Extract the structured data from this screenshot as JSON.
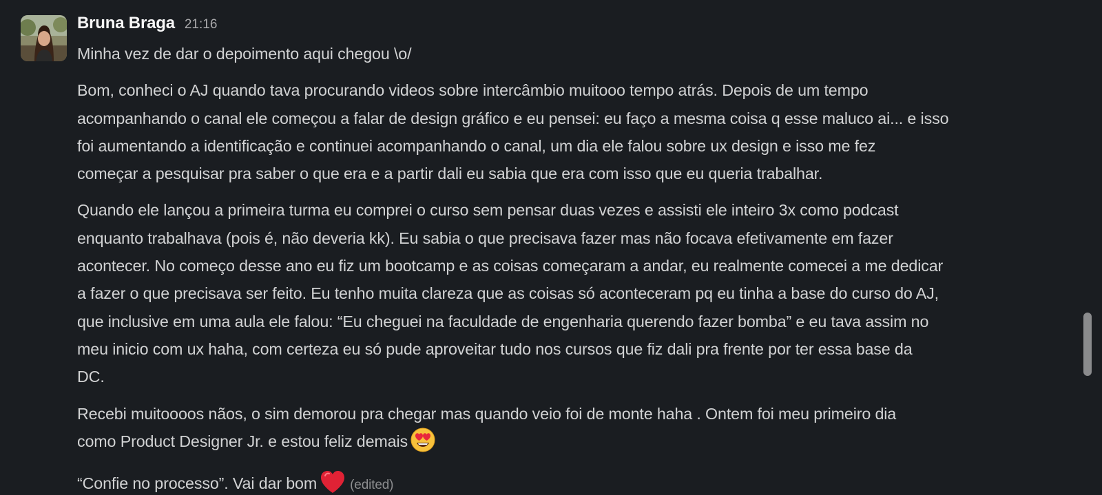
{
  "message": {
    "author": "Bruna Braga",
    "time": "21:16",
    "intro": "Minha vez de dar o depoimento aqui chegou \\o/",
    "p1": [
      "Bom, conheci o AJ quando tava procurando videos sobre intercâmbio muitooo tempo atrás. Depois de um tempo",
      "acompanhando o canal ele começou a falar de design gráfico e eu pensei: eu faço a mesma coisa q esse maluco ai... e isso",
      "foi aumentando a identificação e continuei acompanhando o canal, um dia ele falou sobre ux design e isso me fez",
      "começar a pesquisar pra saber o que era e a partir dali eu sabia que era com isso que eu queria trabalhar."
    ],
    "p2": [
      "Quando ele lançou a primeira turma eu comprei o curso sem pensar duas vezes e assisti ele inteiro 3x como podcast",
      "enquanto trabalhava (pois é, não deveria kk). Eu sabia o que precisava fazer mas não focava efetivamente em fazer",
      "acontecer. No começo desse ano eu fiz um bootcamp e as coisas começaram a andar, eu realmente comecei a me dedicar",
      "a fazer o que precisava ser feito. Eu tenho muita clareza que as coisas só aconteceram pq eu tinha a base do curso do AJ,",
      "que inclusive em uma aula ele falou: “Eu cheguei na faculdade de engenharia querendo fazer bomba” e eu tava assim no",
      "meu inicio com ux haha, com certeza eu só pude aproveitar tudo nos cursos que fiz dali pra frente por ter essa base da",
      "DC."
    ],
    "p3": [
      "Recebi muitoooos nãos, o sim demorou pra chegar mas quando veio foi de monte haha . Ontem foi meu primeiro dia",
      "como Product Designer Jr. e estou feliz demais"
    ],
    "p4": "“Confie no processo”. Vai dar bom",
    "edited": "(edited)",
    "emoji_1": "heart-eyes-emoji",
    "emoji_2": "red-heart-emoji"
  },
  "colors": {
    "background": "#1a1d21",
    "text": "#d1d2d3",
    "author": "#f8f8f8",
    "muted": "#ababad",
    "scrollbar": "#8a8b8d"
  }
}
